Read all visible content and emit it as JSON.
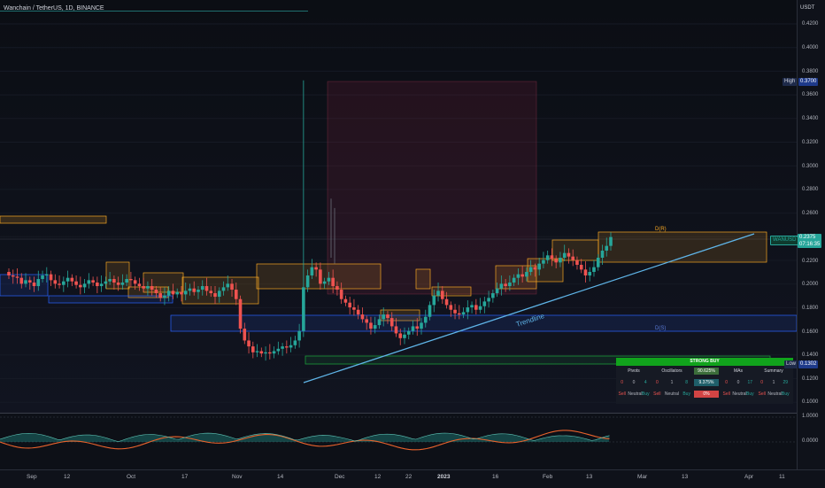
{
  "header": {
    "symbol_title": "Wanchain / TetherUS, 1D, BINANCE",
    "currency": "USDT"
  },
  "price_scale": {
    "ticks": [
      "0.4200",
      "0.4000",
      "0.3800",
      "0.3600",
      "0.3400",
      "0.3200",
      "0.3000",
      "0.2800",
      "0.2600",
      "0.2400",
      "0.2200",
      "0.2000",
      "0.1800",
      "0.1600",
      "0.1400",
      "0.1200",
      "0.1000"
    ],
    "high_label": "High",
    "high_value": "0.3700",
    "low_label": "Low",
    "low_value": "0.1302",
    "symbol_tag": "WANUSDT",
    "last_price": "0.2375",
    "countdown": "07:16:35"
  },
  "oscillator_scale": {
    "ticks": [
      "1.0000",
      "0.0000"
    ]
  },
  "time_axis": {
    "labels": [
      "Sep",
      "12",
      "Oct",
      "17",
      "Nov",
      "14",
      "Dec",
      "12",
      "22",
      "2023",
      "16",
      "Feb",
      "13",
      "Mar",
      "13",
      "Apr",
      "11"
    ]
  },
  "annotations": {
    "trendline_label": "Trendline",
    "resistance_label": "D(R)",
    "support_label": "D(S)"
  },
  "rating_table": {
    "summary_banner": "STRONG BUY",
    "groups": [
      {
        "name": "Pivots",
        "sell": "0",
        "neutral": "0",
        "buy": "4"
      },
      {
        "name": "Oscillators",
        "sell": "0",
        "neutral": "1",
        "buy": "8"
      },
      {
        "name": "MAs",
        "sell": "0",
        "neutral": "0",
        "buy": "17"
      },
      {
        "name": "Summary",
        "sell": "0",
        "neutral": "1",
        "buy": "29"
      }
    ],
    "osc_pct_top": "90.625%",
    "osc_pct_mid": "9.375%",
    "osc_pct_bot": "0%",
    "col_sell": "Sell",
    "col_neutral": "Neutral",
    "col_buy": "Buy"
  },
  "colors": {
    "up": "#26a69a",
    "down": "#ef5350",
    "trendline": "#5fb5e8",
    "zone_orange": "#f5a623",
    "zone_blue": "#2962ff",
    "zone_green": "#1b9a3a",
    "accent_green": "#11a31c"
  }
}
